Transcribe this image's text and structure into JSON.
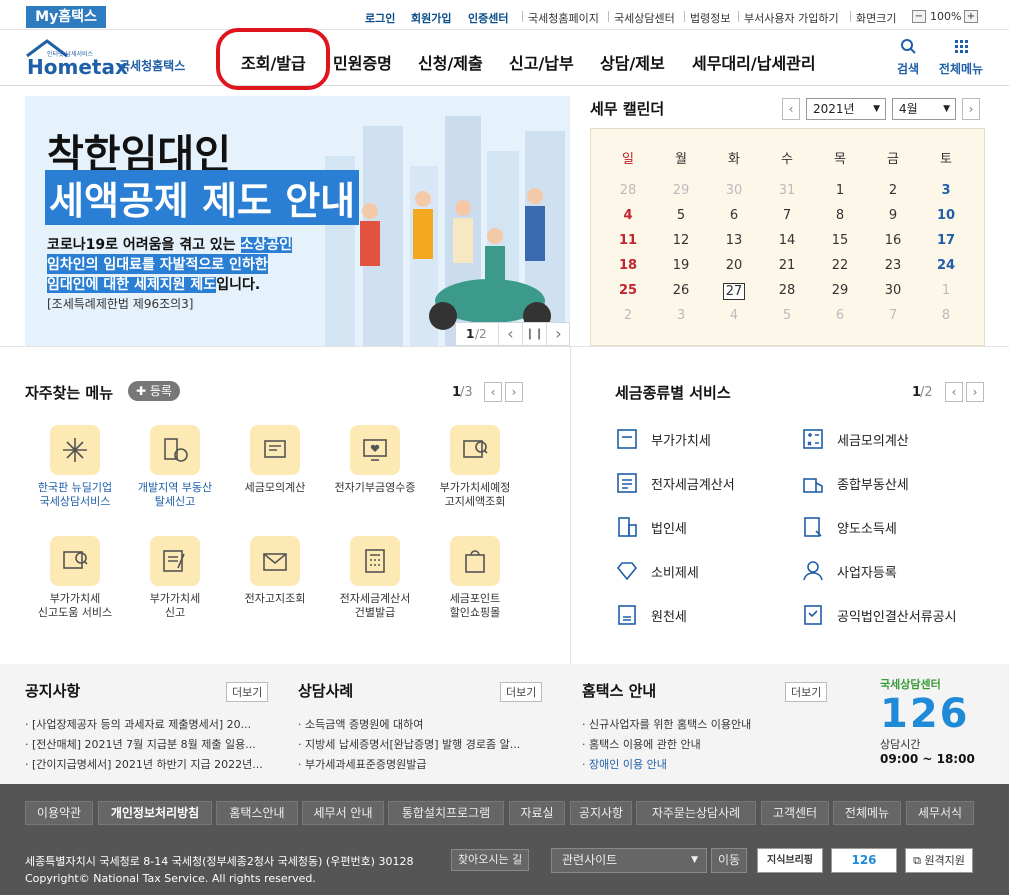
{
  "topbar": {
    "my_hometax": "My홈택스",
    "links": [
      "로그인",
      "회원가입",
      "인증센터",
      "국세청홈페이지",
      "국세상담센터",
      "법령정보",
      "부서사용자 가입하기",
      "화면크기"
    ],
    "zoom": "100%",
    "zoom_minus": "−",
    "zoom_plus": "+"
  },
  "header": {
    "logo_small": "인터넷 납세서비스",
    "logo_main": "Hometax",
    "logo_kr": "국세청홈택스",
    "nav": [
      "조회/발급",
      "민원증명",
      "신청/제출",
      "신고/납부",
      "상담/제보",
      "세무대리/납세관리"
    ],
    "search": "검색",
    "all_menu": "전체메뉴"
  },
  "banner": {
    "title1": "착한임대인",
    "title2": "세액공제 제도 안내",
    "desc1a": "코로나19로 어려움을 겪고 있는 ",
    "desc1b": "소상공인",
    "desc2": "임차인의 임대료를 자발적으로 인하한",
    "desc3a": "임대인에 대한 세제지원 제도",
    "desc3b": "입니다.",
    "law": "[조세특례제한법 제96조의3]",
    "page_current": "1",
    "page_total": "/2"
  },
  "calendar": {
    "title": "세무 캘린더",
    "year": "2021년",
    "month": "4월",
    "weekdays": [
      "일",
      "월",
      "화",
      "수",
      "목",
      "금",
      "토"
    ],
    "weeks": [
      [
        "28",
        "29",
        "30",
        "31",
        "1",
        "2",
        "3"
      ],
      [
        "4",
        "5",
        "6",
        "7",
        "8",
        "9",
        "10"
      ],
      [
        "11",
        "12",
        "13",
        "14",
        "15",
        "16",
        "17"
      ],
      [
        "18",
        "19",
        "20",
        "21",
        "22",
        "23",
        "24"
      ],
      [
        "25",
        "26",
        "27",
        "28",
        "29",
        "30",
        "1"
      ],
      [
        "2",
        "3",
        "4",
        "5",
        "6",
        "7",
        "8"
      ]
    ],
    "today": "27"
  },
  "favorites": {
    "title": "자주찾는 메뉴",
    "register": "등록",
    "page_current": "1",
    "page_total": "/3",
    "items": [
      {
        "label": "한국판 뉴딜기업\n국세상담서비스",
        "icon": "sparkle-icon"
      },
      {
        "label": "개발지역 부동산\n탈세신고",
        "icon": "building-report-icon"
      },
      {
        "label": "세금모의계산",
        "icon": "calculator-doc-icon"
      },
      {
        "label": "전자기부금영수증",
        "icon": "heart-monitor-icon"
      },
      {
        "label": "부가가치세예정\n고지세액조회",
        "icon": "search-doc-icon"
      },
      {
        "label": "부가가치세\n신고도움 서비스",
        "icon": "search-doc-icon"
      },
      {
        "label": "부가가치세\n신고",
        "icon": "vat-pen-icon"
      },
      {
        "label": "전자고지조회",
        "icon": "mail-icon"
      },
      {
        "label": "전자세금계산서\n건별발급",
        "icon": "calculator-icon"
      },
      {
        "label": "세금포인트\n할인쇼핑몰",
        "icon": "shopping-bag-icon"
      }
    ]
  },
  "taxservices": {
    "title": "세금종류별 서비스",
    "page_current": "1",
    "page_total": "/2",
    "left": [
      "부가가치세",
      "전자세금계산서",
      "법인세",
      "소비제세",
      "원천세"
    ],
    "right": [
      "세금모의계산",
      "종합부동산세",
      "양도소득세",
      "사업자등록",
      "공익법인결산서류공시"
    ]
  },
  "notices": {
    "more": "더보기",
    "columns": [
      {
        "title": "공지사항",
        "items": [
          "[사업장제공자 등의 과세자료 제출명세서] 20...",
          "[전산매체] 2021년 7월 지급분 8월 제출 일용...",
          "[간이지급명세서] 2021년 하반기 지급 2022년..."
        ]
      },
      {
        "title": "상담사례",
        "items": [
          "소득금액 증명원에 대하여",
          "지방세 납세증명서[완납증명] 발행 경로좀 알...",
          "부가세과세표준증명원발급"
        ]
      },
      {
        "title": "홈택스 안내",
        "items": [
          "신규사업자를 위한 홈택스 이용안내",
          "홈택스 이용에 관한 안내",
          "장애인 이용 안내"
        ]
      }
    ],
    "center_title": "국세상담센터",
    "center_number": "126",
    "center_hours_label": "상담시간",
    "center_hours": "09:00 ~ 18:00"
  },
  "footer": {
    "links": [
      "이용약관",
      "개인정보처리방침",
      "홈택스안내",
      "세무서 안내",
      "통합설치프로그램",
      "자료실",
      "공지사항",
      "자주묻는상담사례",
      "고객센터",
      "전체메뉴",
      "세무서식"
    ],
    "address": "세종특별자치시 국세청로 8-14 국세청(정부세종2청사 국세청동) (우편번호) 30128",
    "find": "찾아오시는 길",
    "copyright": "Copyright© National Tax Service. All rights reserved.",
    "related": "관련사이트",
    "go": "이동",
    "badge1": "지식브리핑",
    "badge2": "126",
    "remote": "원격지원"
  },
  "colors": {
    "accent": "#1f5fa8",
    "highlight": "#e0141c",
    "sunday": "#c0262d",
    "saturday": "#1f5fa8"
  }
}
